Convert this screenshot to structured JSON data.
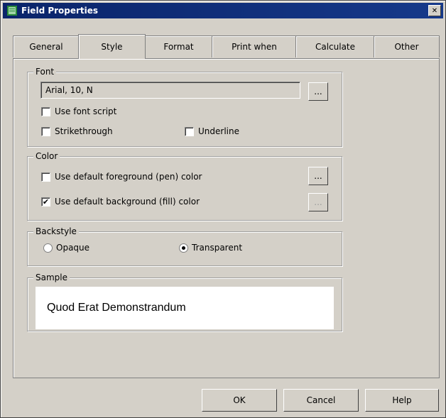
{
  "window": {
    "title": "Field Properties",
    "close_label": "✕"
  },
  "tabs": [
    {
      "label": "General"
    },
    {
      "label": "Style"
    },
    {
      "label": "Format"
    },
    {
      "label": "Print when"
    },
    {
      "label": "Calculate"
    },
    {
      "label": "Other"
    }
  ],
  "active_tab": "Style",
  "font_group": {
    "legend": "Font",
    "font_value": "Arial, 10, N",
    "browse_label": "...",
    "use_font_script": {
      "label": "Use font script",
      "checked": false
    },
    "strikethrough": {
      "label": "Strikethrough",
      "checked": false
    },
    "underline": {
      "label": "Underline",
      "checked": false
    }
  },
  "color_group": {
    "legend": "Color",
    "foreground": {
      "label": "Use default foreground (pen) color",
      "checked": false
    },
    "background": {
      "label": "Use default background (fill) color",
      "checked": true
    },
    "fg_browse_label": "...",
    "bg_browse_label": "..."
  },
  "backstyle_group": {
    "legend": "Backstyle",
    "opaque": {
      "label": "Opaque",
      "selected": false
    },
    "transparent": {
      "label": "Transparent",
      "selected": true
    }
  },
  "sample_group": {
    "legend": "Sample",
    "text": "Quod Erat Demonstrandum"
  },
  "buttons": {
    "ok": "OK",
    "cancel": "Cancel",
    "help": "Help"
  },
  "colors": {
    "titlebar": "#0a246a",
    "face": "#d4d0c8"
  },
  "icons": {
    "app": "window-icon",
    "check_mark": "✔"
  }
}
